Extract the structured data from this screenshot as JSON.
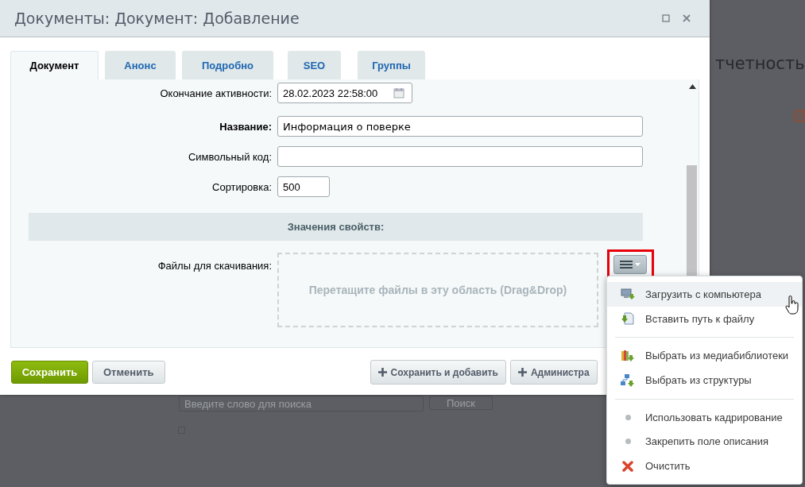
{
  "background": {
    "heading": "тчетность",
    "search": {
      "placeholder": "Введите слово для поиска"
    },
    "search_button": "Поиск",
    "checkbox": {
      "checked": false
    }
  },
  "dialog": {
    "title": "Документы: Документ: Добавление",
    "tabs": [
      {
        "label": "Документ",
        "selected": true
      },
      {
        "label": "Анонс",
        "selected": false
      },
      {
        "label": "Подробно",
        "selected": false
      },
      {
        "label": "SEO",
        "selected": false
      },
      {
        "label": "Группы",
        "selected": false
      }
    ],
    "fields": [
      {
        "label": "Окончание активности:",
        "value": "28.02.2023 22:58:00",
        "kind": "date",
        "required": false
      },
      {
        "label": "Название:",
        "value": "Информация о поверке",
        "kind": "text",
        "required": true
      },
      {
        "label": "Символьный код:",
        "kind": "text",
        "required": false
      },
      {
        "label": "Сортировка:",
        "value": "500",
        "kind": "number",
        "required": false
      }
    ],
    "section": "Значения свойств:",
    "files": {
      "label": "Файлы для скачивания:",
      "dropzone": "Перетащите файлы в эту область (Drag&Drop)"
    },
    "buttons": [
      {
        "label": "Сохранить",
        "kind": "primary"
      },
      {
        "label": "Отменить",
        "kind": "plain"
      },
      {
        "label": "Сохранить и добавить",
        "kind": "add"
      },
      {
        "label": "Администра",
        "kind": "add"
      }
    ]
  },
  "menu": {
    "groups": [
      [
        {
          "label": "Загрузить с компьютера",
          "kind": "computer",
          "highlighted": true
        },
        {
          "label": "Вставить путь к файлу",
          "kind": "file",
          "highlighted": false
        }
      ],
      [
        {
          "label": "Выбрать из медиабиблиотеки",
          "kind": "library",
          "highlighted": false
        },
        {
          "label": "Выбрать из структуры",
          "kind": "structure",
          "highlighted": false
        }
      ],
      [
        {
          "label": "Использовать кадрирование",
          "kind": "bullet",
          "highlighted": false
        },
        {
          "label": "Закрепить поле описания",
          "kind": "bullet",
          "highlighted": false
        },
        {
          "label": "Очистить",
          "kind": "delete",
          "highlighted": false
        }
      ]
    ]
  }
}
